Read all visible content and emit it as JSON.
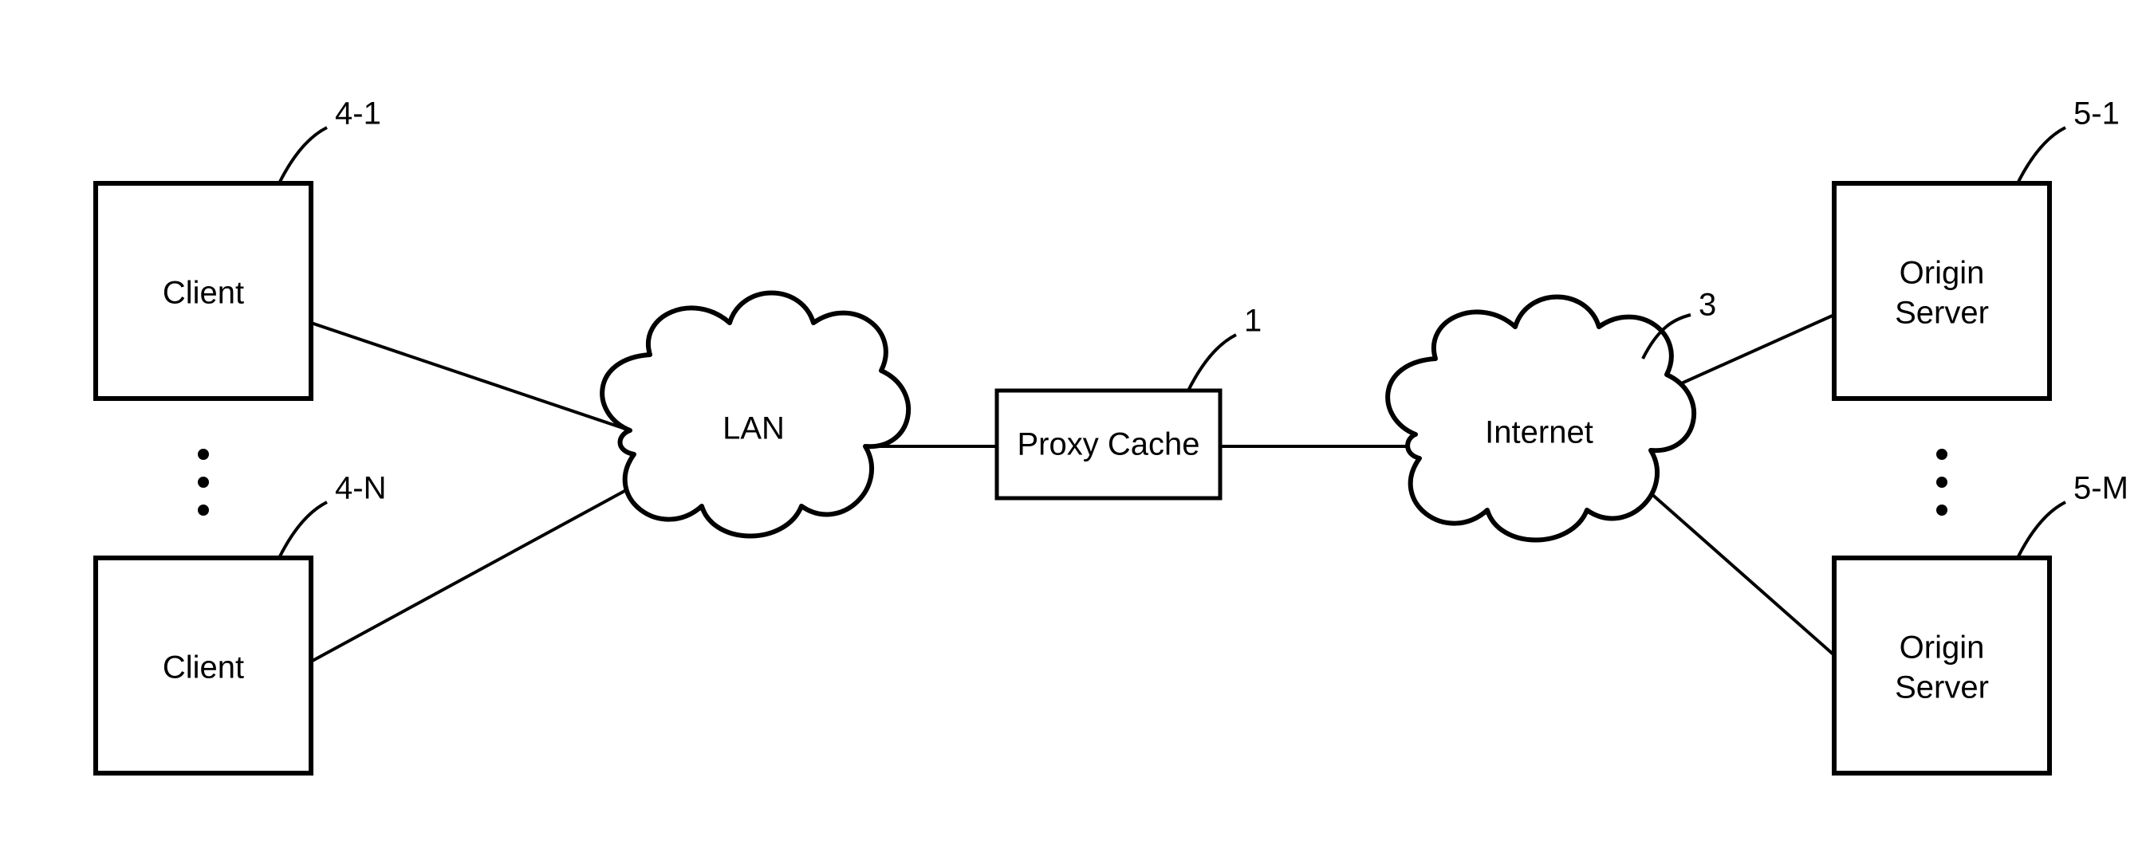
{
  "diagram": {
    "nodes": {
      "client_top": {
        "label": "Client",
        "ref": "4-1"
      },
      "client_bot": {
        "label": "Client",
        "ref": "4-N"
      },
      "lan": {
        "label": "LAN",
        "ref": ""
      },
      "proxy": {
        "label": "Proxy Cache",
        "ref": "1"
      },
      "internet": {
        "label": "Internet",
        "ref": "3"
      },
      "origin_top": {
        "label_line1": "Origin",
        "label_line2": "Server",
        "ref": "5-1"
      },
      "origin_bot": {
        "label_line1": "Origin",
        "label_line2": "Server",
        "ref": "5-M"
      }
    },
    "connections": [
      "client_top → lan",
      "client_bot → lan",
      "lan → proxy",
      "proxy → internet",
      "internet → origin_top",
      "internet → origin_bot"
    ]
  }
}
